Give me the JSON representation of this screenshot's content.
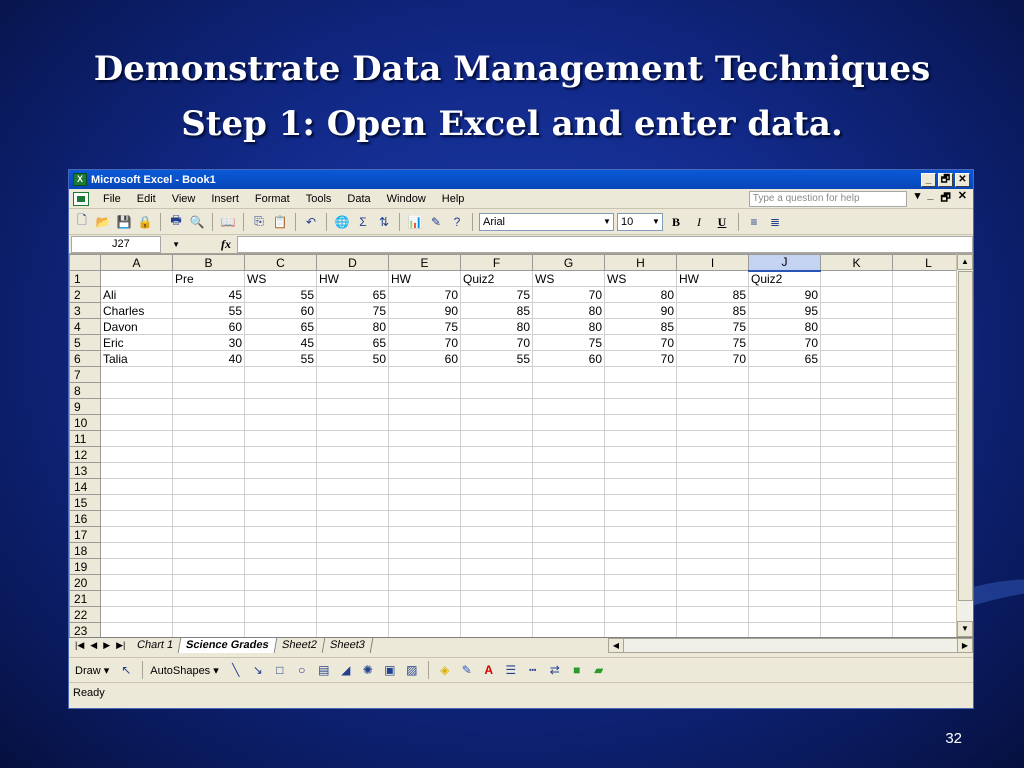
{
  "slide": {
    "title_line1": "Demonstrate Data Management Techniques",
    "title_line2": "Step 1: Open Excel and enter data.",
    "page_number": "32"
  },
  "window": {
    "title": "Microsoft Excel - Book1",
    "minimize": "_",
    "restore": "🗗",
    "close": "✕"
  },
  "menu": {
    "items": [
      "File",
      "Edit",
      "View",
      "Insert",
      "Format",
      "Tools",
      "Data",
      "Window",
      "Help"
    ],
    "help_placeholder": "Type a question for help"
  },
  "toolbar": {
    "font": "Arial",
    "size": "10",
    "bold": "B",
    "italic": "I",
    "underline": "U",
    "sum_symbol": "Σ"
  },
  "formula_bar": {
    "cell_ref": "J27",
    "fx": "fx",
    "value": ""
  },
  "grid": {
    "columns": [
      "A",
      "B",
      "C",
      "D",
      "E",
      "F",
      "G",
      "H",
      "I",
      "J",
      "K",
      "L"
    ],
    "selected_column": "J",
    "rows": [
      [
        "",
        "Pre",
        "WS",
        "HW",
        "HW",
        "Quiz2",
        "WS",
        "WS",
        "HW",
        "Quiz2",
        "",
        ""
      ],
      [
        "Ali",
        "45",
        "55",
        "65",
        "70",
        "75",
        "70",
        "80",
        "85",
        "90",
        "",
        ""
      ],
      [
        "Charles",
        "55",
        "60",
        "75",
        "90",
        "85",
        "80",
        "90",
        "85",
        "95",
        "",
        ""
      ],
      [
        "Davon",
        "60",
        "65",
        "80",
        "75",
        "80",
        "80",
        "85",
        "75",
        "80",
        "",
        ""
      ],
      [
        "Eric",
        "30",
        "45",
        "65",
        "70",
        "70",
        "75",
        "70",
        "75",
        "70",
        "",
        ""
      ],
      [
        "Talia",
        "40",
        "55",
        "50",
        "60",
        "55",
        "60",
        "70",
        "70",
        "65",
        "",
        ""
      ],
      [
        "",
        "",
        "",
        "",
        "",
        "",
        "",
        "",
        "",
        "",
        "",
        ""
      ],
      [
        "",
        "",
        "",
        "",
        "",
        "",
        "",
        "",
        "",
        "",
        "",
        ""
      ],
      [
        "",
        "",
        "",
        "",
        "",
        "",
        "",
        "",
        "",
        "",
        "",
        ""
      ],
      [
        "",
        "",
        "",
        "",
        "",
        "",
        "",
        "",
        "",
        "",
        "",
        ""
      ],
      [
        "",
        "",
        "",
        "",
        "",
        "",
        "",
        "",
        "",
        "",
        "",
        ""
      ],
      [
        "",
        "",
        "",
        "",
        "",
        "",
        "",
        "",
        "",
        "",
        "",
        ""
      ],
      [
        "",
        "",
        "",
        "",
        "",
        "",
        "",
        "",
        "",
        "",
        "",
        ""
      ],
      [
        "",
        "",
        "",
        "",
        "",
        "",
        "",
        "",
        "",
        "",
        "",
        ""
      ],
      [
        "",
        "",
        "",
        "",
        "",
        "",
        "",
        "",
        "",
        "",
        "",
        ""
      ],
      [
        "",
        "",
        "",
        "",
        "",
        "",
        "",
        "",
        "",
        "",
        "",
        ""
      ],
      [
        "",
        "",
        "",
        "",
        "",
        "",
        "",
        "",
        "",
        "",
        "",
        ""
      ],
      [
        "",
        "",
        "",
        "",
        "",
        "",
        "",
        "",
        "",
        "",
        "",
        ""
      ],
      [
        "",
        "",
        "",
        "",
        "",
        "",
        "",
        "",
        "",
        "",
        "",
        ""
      ],
      [
        "",
        "",
        "",
        "",
        "",
        "",
        "",
        "",
        "",
        "",
        "",
        ""
      ],
      [
        "",
        "",
        "",
        "",
        "",
        "",
        "",
        "",
        "",
        "",
        "",
        ""
      ],
      [
        "",
        "",
        "",
        "",
        "",
        "",
        "",
        "",
        "",
        "",
        "",
        ""
      ],
      [
        "",
        "",
        "",
        "",
        "",
        "",
        "",
        "",
        "",
        "",
        "",
        ""
      ],
      [
        "",
        "",
        "",
        "",
        "",
        "",
        "",
        "",
        "",
        "",
        "",
        ""
      ]
    ]
  },
  "sheets": {
    "tabs": [
      "Chart 1",
      "Science Grades",
      "Sheet2",
      "Sheet3"
    ],
    "active": "Science Grades"
  },
  "drawing": {
    "draw_label": "Draw ▾",
    "autoshapes_label": "AutoShapes ▾"
  },
  "status": {
    "text": "Ready"
  }
}
